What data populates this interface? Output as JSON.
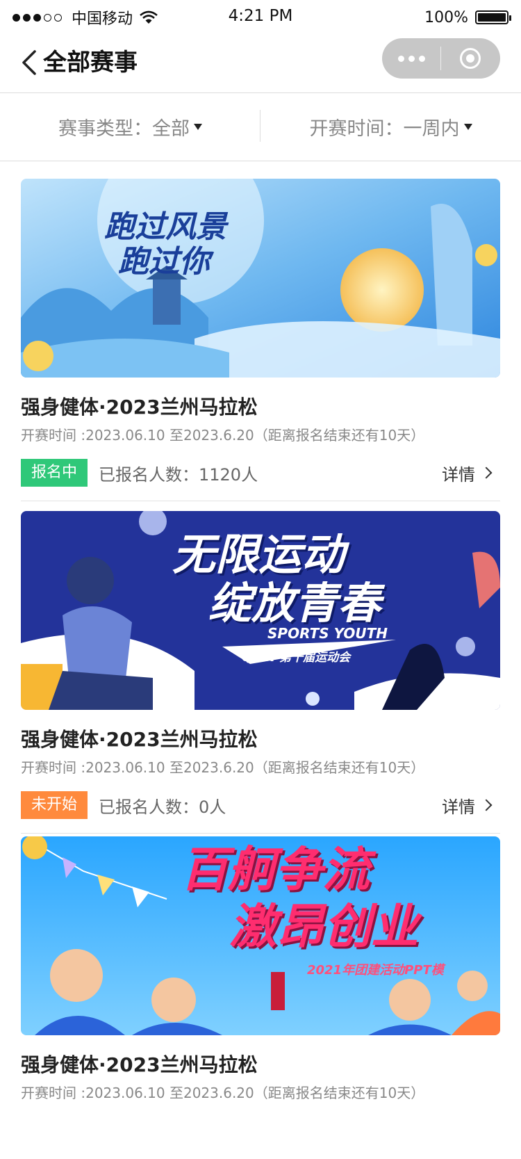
{
  "status_bar": {
    "carrier": "中国移动",
    "time": "4:21 PM",
    "battery": "100%"
  },
  "nav": {
    "title": "全部赛事"
  },
  "filters": {
    "type_label": "赛事类型：全部",
    "time_label": "开赛时间：一周内"
  },
  "events": [
    {
      "banner_text_1": "跑过风景",
      "banner_text_2": "跑过你",
      "title": "强身健体·2023兰州马拉松",
      "time": "开赛时间 :2023.06.10 至2023.6.20（距离报名结束还有10天）",
      "status": "报名中",
      "count": "已报名人数：1120人",
      "detail": "详情"
    },
    {
      "banner_text_1": "无限运动",
      "banner_text_2": "绽放青春",
      "banner_text_3": "SPORTS YOUTH",
      "banner_text_4": "QIAN 第十届运动会",
      "title": "强身健体·2023兰州马拉松",
      "time": "开赛时间 :2023.06.10 至2023.6.20（距离报名结束还有10天）",
      "status": "未开始",
      "count": "已报名人数：0人",
      "detail": "详情"
    },
    {
      "banner_text_1": "百舸争流",
      "banner_text_2": "激昂创业",
      "banner_text_3": "2021年团建活动PPT模",
      "title": "强身健体·2023兰州马拉松",
      "time": "开赛时间 :2023.06.10 至2023.6.20（距离报名结束还有10天）"
    }
  ],
  "colors": {
    "status_green": "#2fc879",
    "status_orange": "#ff8a3d"
  }
}
